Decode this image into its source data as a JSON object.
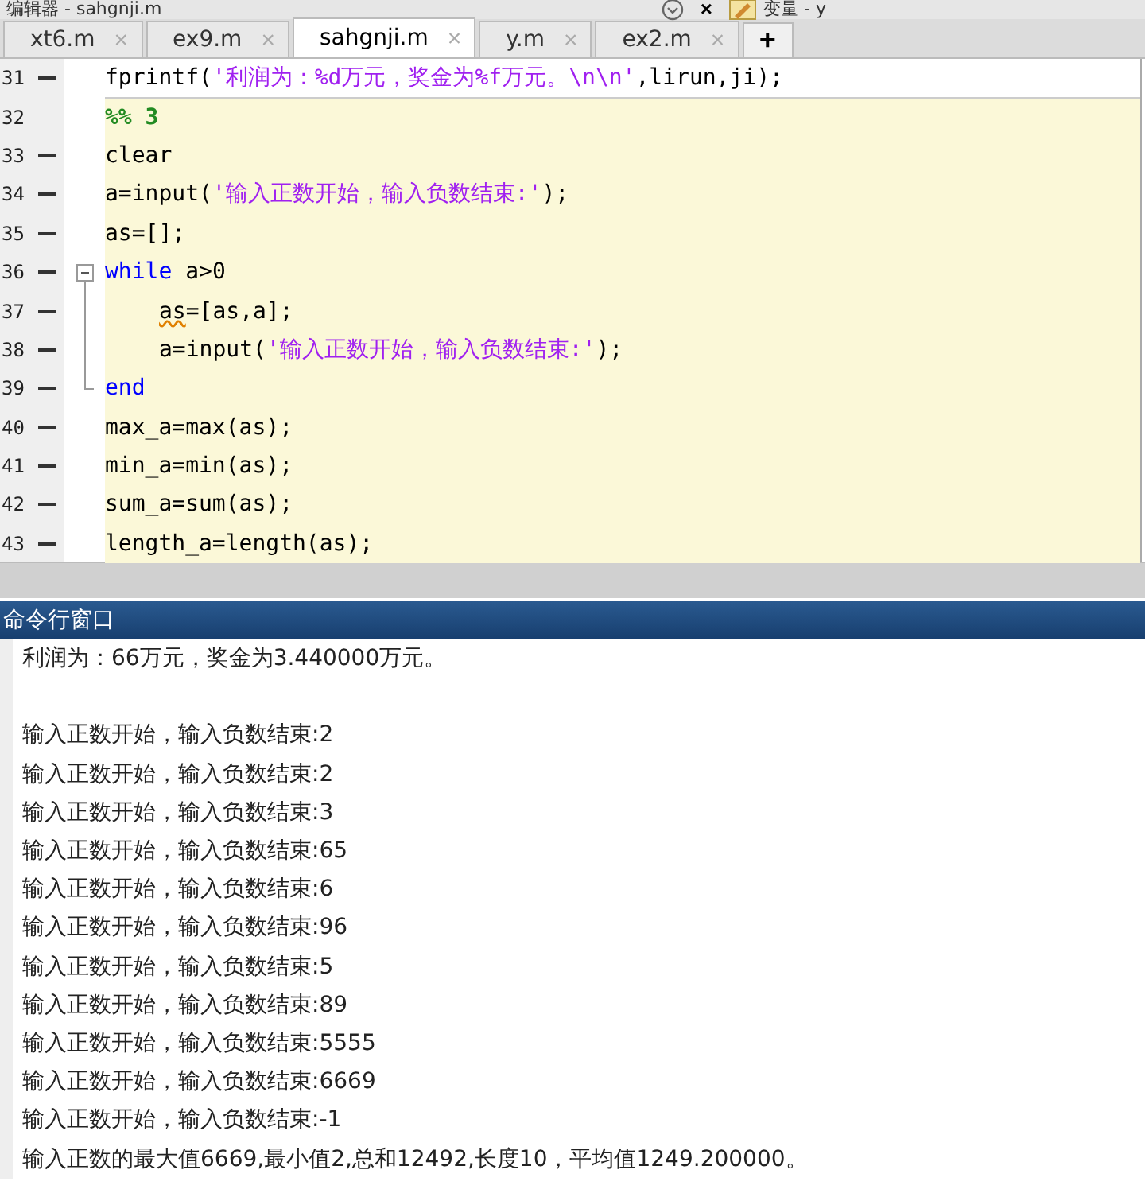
{
  "window": {
    "title": "编辑器 - sahgnji.m",
    "close": "×",
    "side_title": "变量 - y"
  },
  "tabs": [
    {
      "label": "xt6.m",
      "close": "×",
      "selected": false
    },
    {
      "label": "ex9.m",
      "close": "×",
      "selected": false
    },
    {
      "label": "sahgnji.m",
      "close": "×",
      "selected": true
    },
    {
      "label": "y.m",
      "close": "×",
      "selected": false
    },
    {
      "label": "ex2.m",
      "close": "×",
      "selected": false
    }
  ],
  "add_tab": "+",
  "editor": {
    "lines": [
      {
        "number": "31",
        "executable": true,
        "in_cell": false,
        "segments": [
          {
            "kind": "plain",
            "text": "fprintf("
          },
          {
            "kind": "string",
            "text": "'利润为：%d万元，奖金为%f万元。\\n\\n'"
          },
          {
            "kind": "plain",
            "text": ",lirun,ji);"
          }
        ]
      },
      {
        "number": "32",
        "executable": false,
        "in_cell": true,
        "segments": [
          {
            "kind": "cell",
            "text": "%% 3"
          }
        ]
      },
      {
        "number": "33",
        "executable": true,
        "in_cell": true,
        "segments": [
          {
            "kind": "plain",
            "text": "clear"
          }
        ]
      },
      {
        "number": "34",
        "executable": true,
        "in_cell": true,
        "segments": [
          {
            "kind": "plain",
            "text": "a=input("
          },
          {
            "kind": "string",
            "text": "'输入正数开始，输入负数结束:'"
          },
          {
            "kind": "plain",
            "text": ");"
          }
        ]
      },
      {
        "number": "35",
        "executable": true,
        "in_cell": true,
        "segments": [
          {
            "kind": "plain",
            "text": "as=[];"
          }
        ]
      },
      {
        "number": "36",
        "executable": true,
        "in_cell": true,
        "segments": [
          {
            "kind": "keyword",
            "text": "while"
          },
          {
            "kind": "plain",
            "text": " a>0"
          }
        ],
        "children": [
          {
            "number": "37",
            "executable": true,
            "in_cell": true,
            "segments": [
              {
                "kind": "warning",
                "text": "as"
              },
              {
                "kind": "plain",
                "text": "=[as,a];"
              }
            ]
          },
          {
            "number": "38",
            "executable": true,
            "in_cell": true,
            "segments": [
              {
                "kind": "plain",
                "text": "a=input("
              },
              {
                "kind": "string",
                "text": "'输入正数开始，输入负数结束:'"
              },
              {
                "kind": "plain",
                "text": ");"
              }
            ]
          }
        ]
      },
      {
        "number": "39",
        "executable": true,
        "in_cell": true,
        "segments": [
          {
            "kind": "keyword",
            "text": "end"
          }
        ]
      },
      {
        "number": "40",
        "executable": true,
        "in_cell": true,
        "segments": [
          {
            "kind": "plain",
            "text": "max_a=max(as);"
          }
        ]
      },
      {
        "number": "41",
        "executable": true,
        "in_cell": true,
        "segments": [
          {
            "kind": "plain",
            "text": "min_a=min(as);"
          }
        ]
      },
      {
        "number": "42",
        "executable": true,
        "in_cell": true,
        "segments": [
          {
            "kind": "plain",
            "text": "sum_a=sum(as);"
          }
        ]
      },
      {
        "number": "43",
        "executable": true,
        "in_cell": true,
        "segments": [
          {
            "kind": "plain",
            "text": "length_a=length(as);"
          }
        ]
      }
    ]
  },
  "command_window": {
    "title": "命令行窗口",
    "previous_output": "利润为：66万元，奖金为3.440000万元。",
    "output": [
      "输入正数开始，输入负数结束:2",
      "输入正数开始，输入负数结束:2",
      "输入正数开始，输入负数结束:3",
      "输入正数开始，输入负数结束:65",
      "输入正数开始，输入负数结束:6",
      "输入正数开始，输入负数结束:96",
      "输入正数开始，输入负数结束:5",
      "输入正数开始，输入负数结束:89",
      "输入正数开始，输入负数结束:5555",
      "输入正数开始，输入负数结束:6669",
      "输入正数开始，输入负数结束:-1",
      "输入正数的最大值6669,最小值2,总和12492,长度10，平均值1249.200000。"
    ]
  }
}
